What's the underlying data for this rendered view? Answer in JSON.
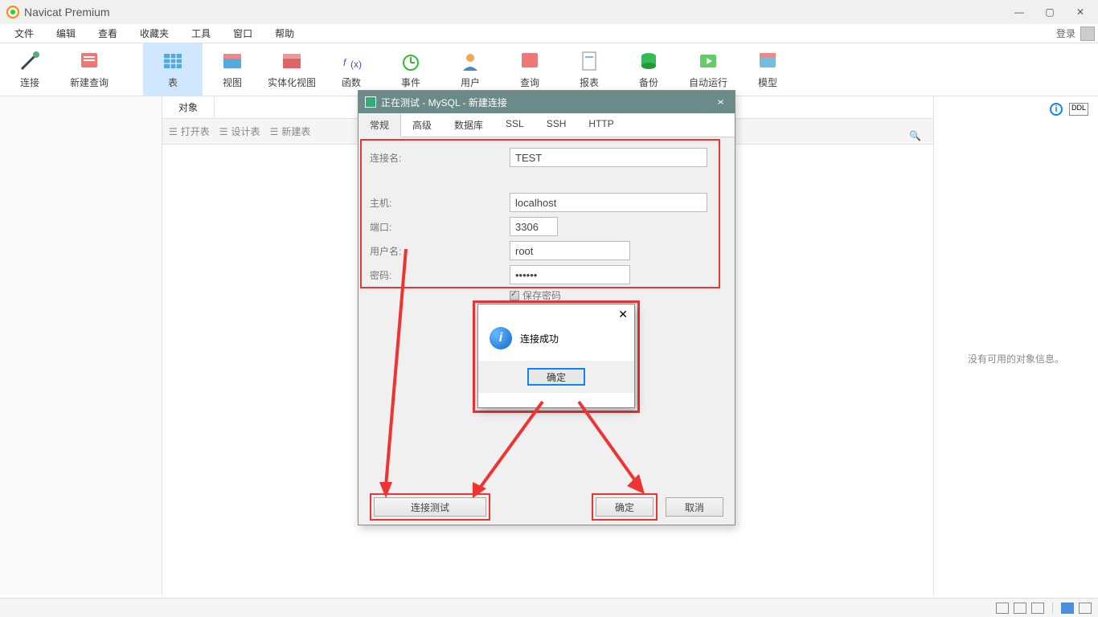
{
  "app": {
    "title": "Navicat Premium"
  },
  "menu": {
    "file": "文件",
    "edit": "编辑",
    "view": "查看",
    "favorites": "收藏夹",
    "tools": "工具",
    "window": "窗口",
    "help": "帮助",
    "login": "登录"
  },
  "toolbar": {
    "connection": "连接",
    "query": "新建查询",
    "table": "表",
    "view": "视图",
    "matview": "实体化视图",
    "function": "函数",
    "event": "事件",
    "user": "用户",
    "query2": "查询",
    "report": "报表",
    "backup": "备份",
    "autorun": "自动运行",
    "model": "模型"
  },
  "objects": {
    "tab": "对象",
    "open": "打开表",
    "design": "设计表",
    "new": "新建表"
  },
  "info": {
    "noinfo": "没有可用的对象信息。"
  },
  "dialog": {
    "title": "正在测试 - MySQL - 新建连接",
    "tabs": {
      "general": "常规",
      "advanced": "高级",
      "database": "数据库",
      "ssl": "SSL",
      "ssh": "SSH",
      "http": "HTTP"
    },
    "labels": {
      "connname": "连接名:",
      "host": "主机:",
      "port": "端口:",
      "user": "用户名:",
      "password": "密码:",
      "savepw": "保存密码"
    },
    "values": {
      "connname": "TEST",
      "host": "localhost",
      "port": "3306",
      "user": "root",
      "password": "••••••"
    },
    "buttons": {
      "test": "连接测试",
      "ok": "确定",
      "cancel": "取消"
    }
  },
  "msgbox": {
    "text": "连接成功",
    "ok": "确定"
  }
}
